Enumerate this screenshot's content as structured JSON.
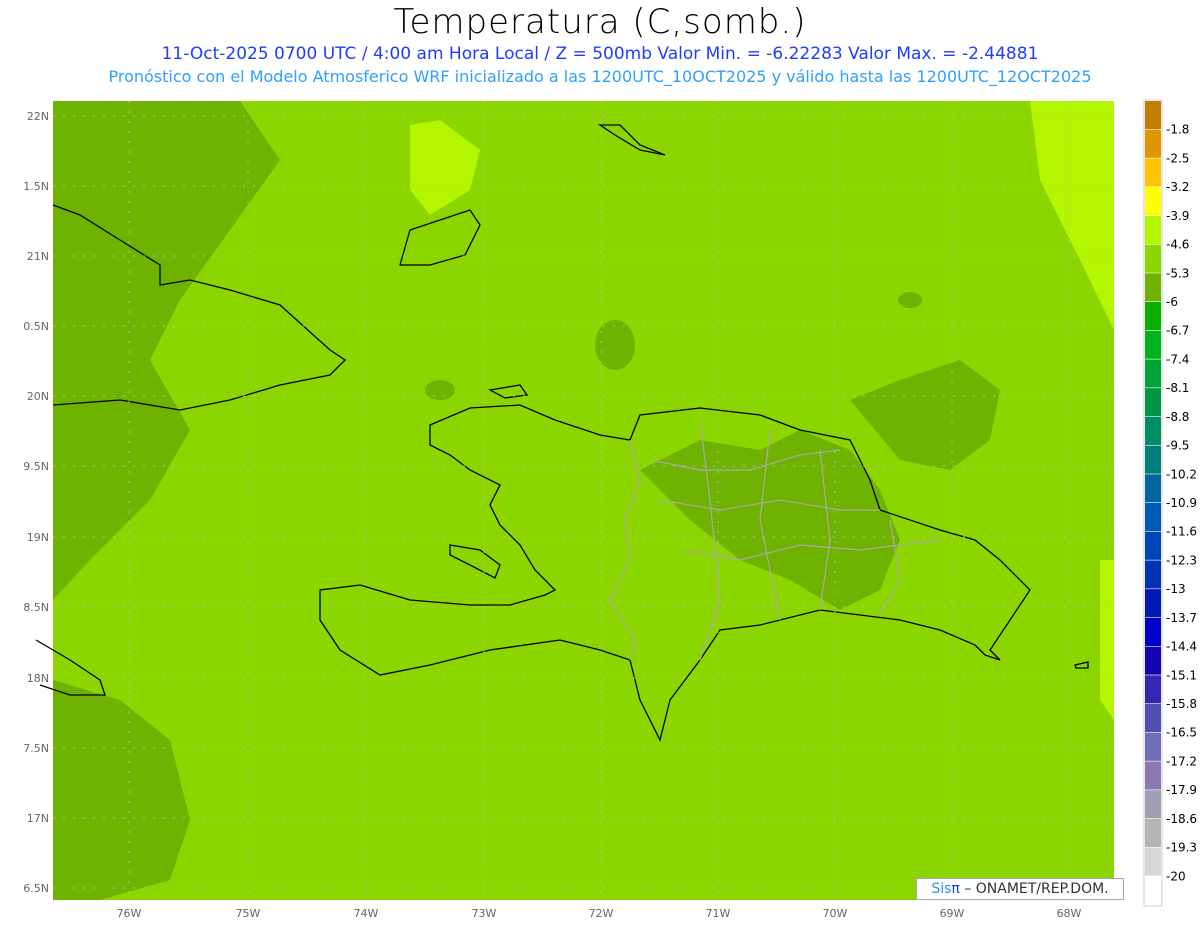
{
  "header": {
    "title": "Temperatura (C,somb.)",
    "subtitle1": "11-Oct-2025  0700 UTC / 4:00 am Hora Local / Z = 500mb  Valor Min. = -6.22283  Valor Max. = -2.44881",
    "subtitle2": "Pronóstico con el Modelo Atmosferico WRF inicializado a las 1200UTC_10OCT2025 y válido hasta las  1200UTC_12OCT2025"
  },
  "map": {
    "lat_labels": [
      "22N",
      "1.5N",
      "21N",
      "0.5N",
      "20N",
      "9.5N",
      "19N",
      "8.5N",
      "18N",
      "7.5N",
      "17N",
      "6.5N"
    ],
    "lon_labels": [
      "76W",
      "75W",
      "74W",
      "73W",
      "72W",
      "71W",
      "70W",
      "69W",
      "68W"
    ],
    "field_colors": {
      "base": "#8cd600",
      "dark": "#6db300",
      "light": "#b4f500"
    }
  },
  "colorbar": {
    "labels": [
      "-1.8",
      "-2.5",
      "-3.2",
      "-3.9",
      "-4.6",
      "-5.3",
      "-6",
      "-6.7",
      "-7.4",
      "-8.1",
      "-8.8",
      "-9.5",
      "-10.2",
      "-10.9",
      "-11.6",
      "-12.3",
      "-13",
      "-13.7",
      "-14.4",
      "-15.1",
      "-15.8",
      "-16.5",
      "-17.2",
      "-17.9",
      "-18.6",
      "-19.3",
      "-20"
    ],
    "colors": [
      "#c07f00",
      "#e09600",
      "#ffc300",
      "#ffff00",
      "#b4f500",
      "#8cd600",
      "#6db300",
      "#0aaf00",
      "#00b41e",
      "#00a537",
      "#009646",
      "#008c64",
      "#007d7d",
      "#00669e",
      "#0058b9",
      "#0045b4",
      "#0032b4",
      "#0019b4",
      "#0000c8",
      "#1405b4",
      "#3228b4",
      "#5050b4",
      "#6e6eb4",
      "#8c78b4",
      "#a0a0b4",
      "#b4b4b4",
      "#d7d7d7",
      "#ffffff"
    ]
  },
  "credit": {
    "sis": "Sis",
    "pi": "π",
    "rest": " – ONAMET/REP.DOM."
  }
}
